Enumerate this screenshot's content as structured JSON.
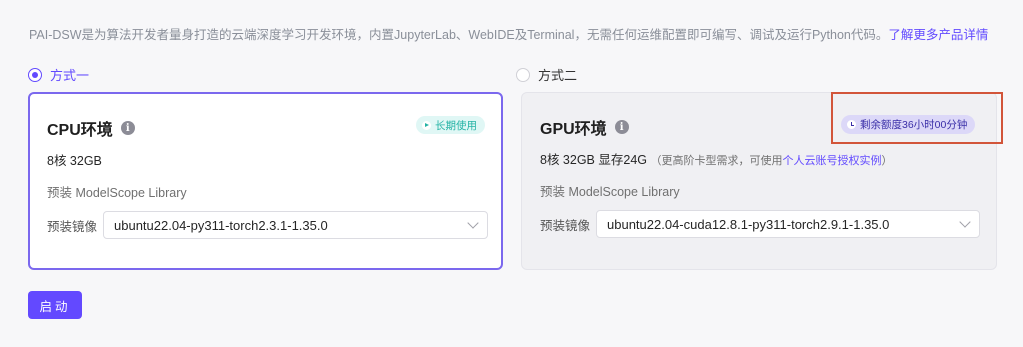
{
  "intro": {
    "text": "PAI-DSW是为算法开发者量身打造的云端深度学习开发环境，内置JupyterLab、WebIDE及Terminal，无需任何运维配置即可编写、调试及运行Python代码。",
    "link": "了解更多产品详情"
  },
  "options": [
    {
      "label": "方式一",
      "checked": true
    },
    {
      "label": "方式二",
      "checked": false
    }
  ],
  "cpu_card": {
    "title": "CPU环境",
    "info_icon": "info-icon",
    "badge": "长期使用",
    "spec": "8核 32GB",
    "preinstall": "预装 ModelScope Library",
    "image_label": "预装镜像",
    "image_value": "ubuntu22.04-py311-torch2.3.1-1.35.0"
  },
  "gpu_card": {
    "title": "GPU环境",
    "info_icon": "info-icon",
    "badge": "剩余额度36小时00分钟",
    "spec": "8核 32GB 显存24G",
    "spec_sub_prefix": "（更高阶卡型需求，可使用",
    "spec_sub_link": "个人云账号授权实例",
    "spec_sub_suffix": "）",
    "preinstall": "预装 ModelScope Library",
    "image_label": "预装镜像",
    "image_value": "ubuntu22.04-cuda12.8.1-py311-torch2.9.1-1.35.0"
  },
  "start_button": "启动",
  "colors": {
    "accent": "#624aff",
    "highlight": "#d2553a",
    "badge_green": "#25b3a5"
  }
}
